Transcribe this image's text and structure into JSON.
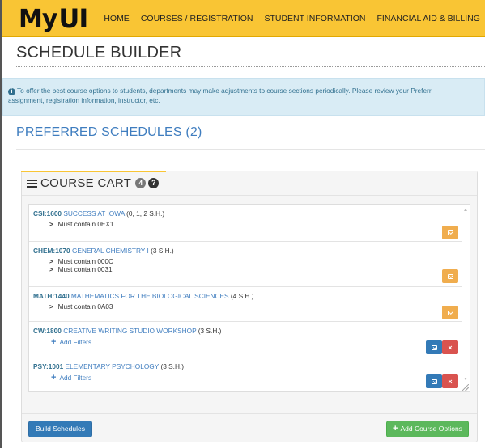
{
  "nav": {
    "logo_main": "My",
    "logo_ui": "UI",
    "links": [
      "HOME",
      "COURSES / REGISTRATION",
      "STUDENT INFORMATION",
      "FINANCIAL AID & BILLING"
    ]
  },
  "page": {
    "title": "SCHEDULE BUILDER",
    "info_line1": "To offer the best course options to students, departments may make adjustments to course sections periodically. Please review your Preferr",
    "info_line2": "assignment, registration information, instructor, etc.",
    "info_icon": "info-icon",
    "preferred_title": "PREFERRED SCHEDULES (2)"
  },
  "cart": {
    "title": "COURSE CART",
    "badge": "4",
    "help_glyph": "?",
    "courses": [
      {
        "code": "CSI:1600",
        "name": "SUCCESS AT IOWA",
        "hours": "(0, 1, 2 S.H.)",
        "filters": [
          "Must contain 0EX1"
        ]
      },
      {
        "code": "CHEM:1070",
        "name": "GENERAL CHEMISTRY I",
        "hours": "(3 S.H.)",
        "filters": [
          "Must contain 000C",
          "Must contain 0031"
        ]
      },
      {
        "code": "MATH:1440",
        "name": "MATHEMATICS FOR THE BIOLOGICAL SCIENCES",
        "hours": "(4 S.H.)",
        "filters": [
          "Must contain 0A03"
        ]
      },
      {
        "code": "CW:1800",
        "name": "CREATIVE WRITING STUDIO WORKSHOP",
        "hours": "(3 S.H.)",
        "add_filters": "Add Filters"
      },
      {
        "code": "PSY:1001",
        "name": "ELEMENTARY PSYCHOLOGY",
        "hours": "(3 S.H.)",
        "add_filters": "Add Filters"
      }
    ],
    "remove_glyph": "×",
    "build_label": "Build Schedules",
    "add_options_label": "Add Course Options",
    "plus_glyph": "+",
    "chevron_glyph": ">"
  },
  "colors": {
    "nav_bg": "#f9c534",
    "link_blue": "#3f7dbf",
    "btn_orange": "#f0ad4e",
    "btn_blue": "#337ab7",
    "btn_red": "#d9534f",
    "btn_green": "#5cb85c"
  }
}
